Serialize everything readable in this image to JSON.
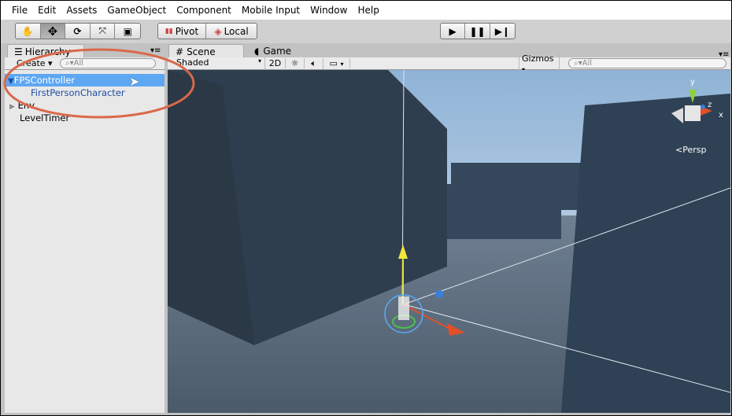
{
  "menu": [
    "File",
    "Edit",
    "Assets",
    "GameObject",
    "Component",
    "Mobile Input",
    "Window",
    "Help"
  ],
  "toolbar": {
    "tools": [
      "hand-icon",
      "move-icon",
      "rotate-icon",
      "scale-icon",
      "rect-icon"
    ],
    "active_tool": "move-icon",
    "pivot_label": "Pivot",
    "local_label": "Local",
    "play": [
      "play-icon",
      "pause-icon",
      "step-icon"
    ]
  },
  "hierarchy": {
    "tab_label": "Hierarchy",
    "create_label": "Create",
    "search_placeholder": "All",
    "items": [
      {
        "label": "FPSController",
        "selected": true,
        "expanded": true,
        "indent": 0
      },
      {
        "label": "FirstPersonCharacter",
        "indent": 1
      },
      {
        "label": "Env",
        "collapsed": true,
        "indent": 0
      },
      {
        "label": "LevelTimer",
        "indent": 0
      }
    ]
  },
  "scene": {
    "tabs": [
      "Scene",
      "Game"
    ],
    "shading": "Shaded",
    "mode_2d": "2D",
    "gizmos_label": "Gizmos",
    "search_placeholder": "All",
    "persp_label": "Persp",
    "axis_labels": {
      "x": "x",
      "y": "y",
      "z": "z"
    }
  },
  "colors": {
    "selection": "#5ea7f2",
    "highlight_circle": "#d9694a",
    "sky": "#a8c4df",
    "block": "#2c3a4a"
  }
}
